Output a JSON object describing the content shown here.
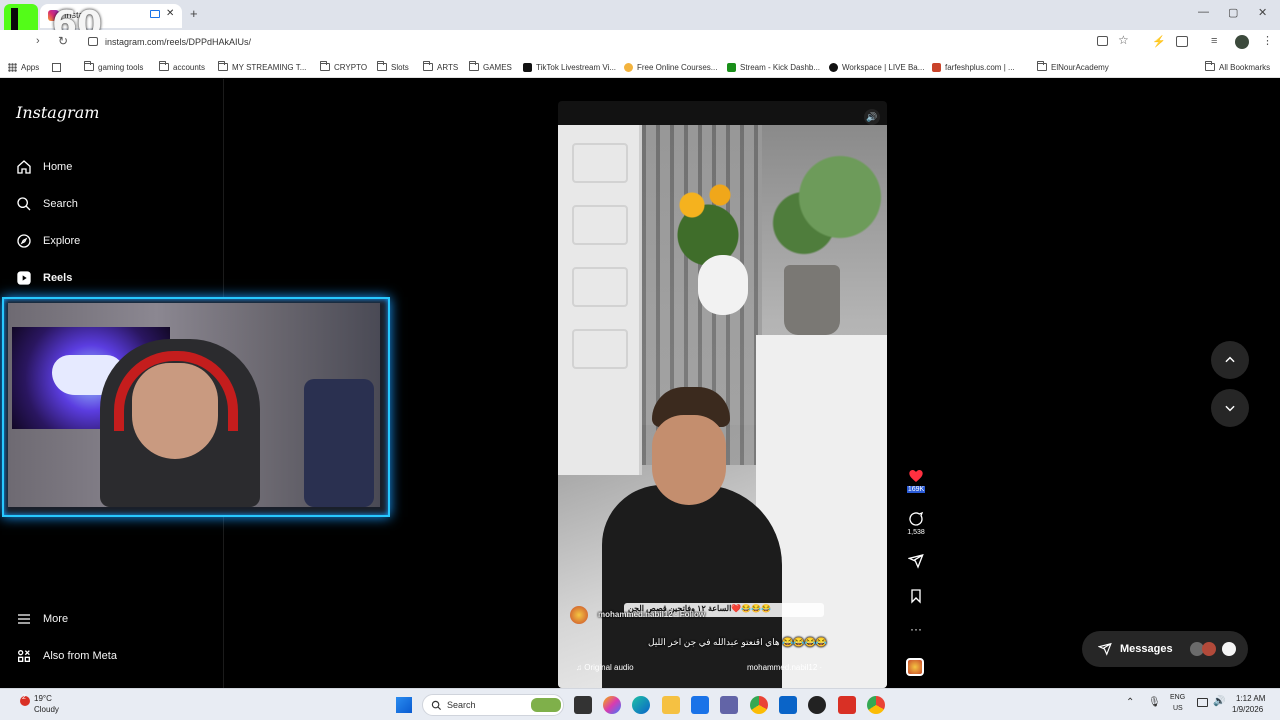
{
  "browser": {
    "tab_title": "Insta",
    "new_tab": "+",
    "url": "instagram.com/reels/DPPdHAkAIUs/",
    "window_controls": {
      "minimize": "—",
      "maximize": "▢",
      "close": "✕"
    }
  },
  "overlay": {
    "counter": "60"
  },
  "bookmarks": [
    {
      "label": "Apps",
      "icon": "apps-grid-icon"
    },
    {
      "label": "",
      "icon": "tab-groups-icon"
    },
    {
      "label": "gaming tools",
      "icon": "folder-icon"
    },
    {
      "label": "accounts",
      "icon": "folder-icon"
    },
    {
      "label": "MY STREAMING T...",
      "icon": "folder-icon"
    },
    {
      "label": "CRYPTO",
      "icon": "folder-icon"
    },
    {
      "label": "Slots",
      "icon": "folder-icon"
    },
    {
      "label": "ARTS",
      "icon": "folder-icon"
    },
    {
      "label": "GAMES",
      "icon": "folder-icon"
    },
    {
      "label": "TikTok Livestream Vi...",
      "icon": "site-icon"
    },
    {
      "label": "Free Online Courses...",
      "icon": "site-icon"
    },
    {
      "label": "Stream - Kick Dashb...",
      "icon": "kick-icon"
    },
    {
      "label": "Workspace | LIVE Ba...",
      "icon": "tiktok-icon"
    },
    {
      "label": "farfeshplus.com | ...",
      "icon": "site-icon"
    },
    {
      "label": "ElNourAcademy",
      "icon": "folder-icon"
    },
    {
      "label": "All Bookmarks",
      "icon": "folder-icon"
    }
  ],
  "instagram": {
    "logo": "Instagram",
    "nav": [
      {
        "label": "Home",
        "icon": "home-icon"
      },
      {
        "label": "Search",
        "icon": "search-icon"
      },
      {
        "label": "Explore",
        "icon": "explore-icon"
      },
      {
        "label": "Reels",
        "icon": "reels-icon",
        "active": true
      },
      {
        "label": "More",
        "icon": "menu-icon"
      },
      {
        "label": "Also from Meta",
        "icon": "meta-icon"
      }
    ]
  },
  "reel": {
    "caption_overlay_top": "الساعة ١٢ وفاتحين قصص الجن❤️😂😂😂",
    "author_overlay": "mohammed.nabil12 · Follow",
    "caption": "هاي اقنعتو عبدالله في جن اخر الليل 😂😂😂😂",
    "audio": "Original audio",
    "author": "mohammed.nabil12 ·",
    "likes": "169K",
    "comments": "1,538"
  },
  "side_controls": {
    "up": "up",
    "down": "down"
  },
  "messages": {
    "label": "Messages"
  },
  "taskbar": {
    "weather_temp": "19°C",
    "weather_desc": "Cloudy",
    "search_placeholder": "Search",
    "lang_top": "ENG",
    "lang_bottom": "US",
    "time": "1:12 AM",
    "date": "1/9/2026",
    "notif_count": "2"
  },
  "colors": {
    "accent_blue": "#27c8ff",
    "like_red": "#ff3040",
    "kick_green": "#53fc18"
  }
}
